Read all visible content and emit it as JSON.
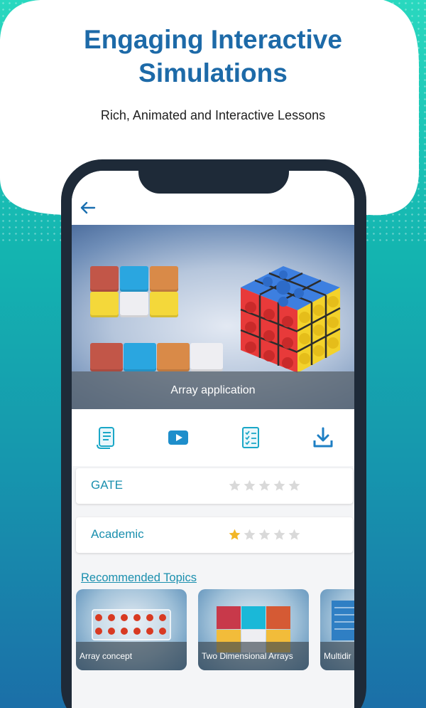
{
  "headline": {
    "line1": "Engaging Interactive",
    "line2": "Simulations",
    "subtitle": "Rich, Animated and Interactive Lessons"
  },
  "colors": {
    "title": "#1d6aa8",
    "accent": "#1a8fae",
    "star_filled": "#f2b626",
    "star_empty": "#d9d9d9"
  },
  "hero": {
    "caption": "Array application"
  },
  "actions": [
    {
      "icon": "document-scroll-icon"
    },
    {
      "icon": "play-video-icon"
    },
    {
      "icon": "checklist-icon"
    },
    {
      "icon": "download-icon"
    }
  ],
  "ratings": [
    {
      "label": "GATE",
      "stars": 0,
      "max": 5
    },
    {
      "label": "Academic",
      "stars": 1,
      "max": 5
    }
  ],
  "recommended": {
    "title": "Recommended Topics",
    "topics": [
      {
        "label": "Array concept"
      },
      {
        "label": "Two Dimensional Arrays"
      },
      {
        "label": "Multidir"
      }
    ]
  }
}
